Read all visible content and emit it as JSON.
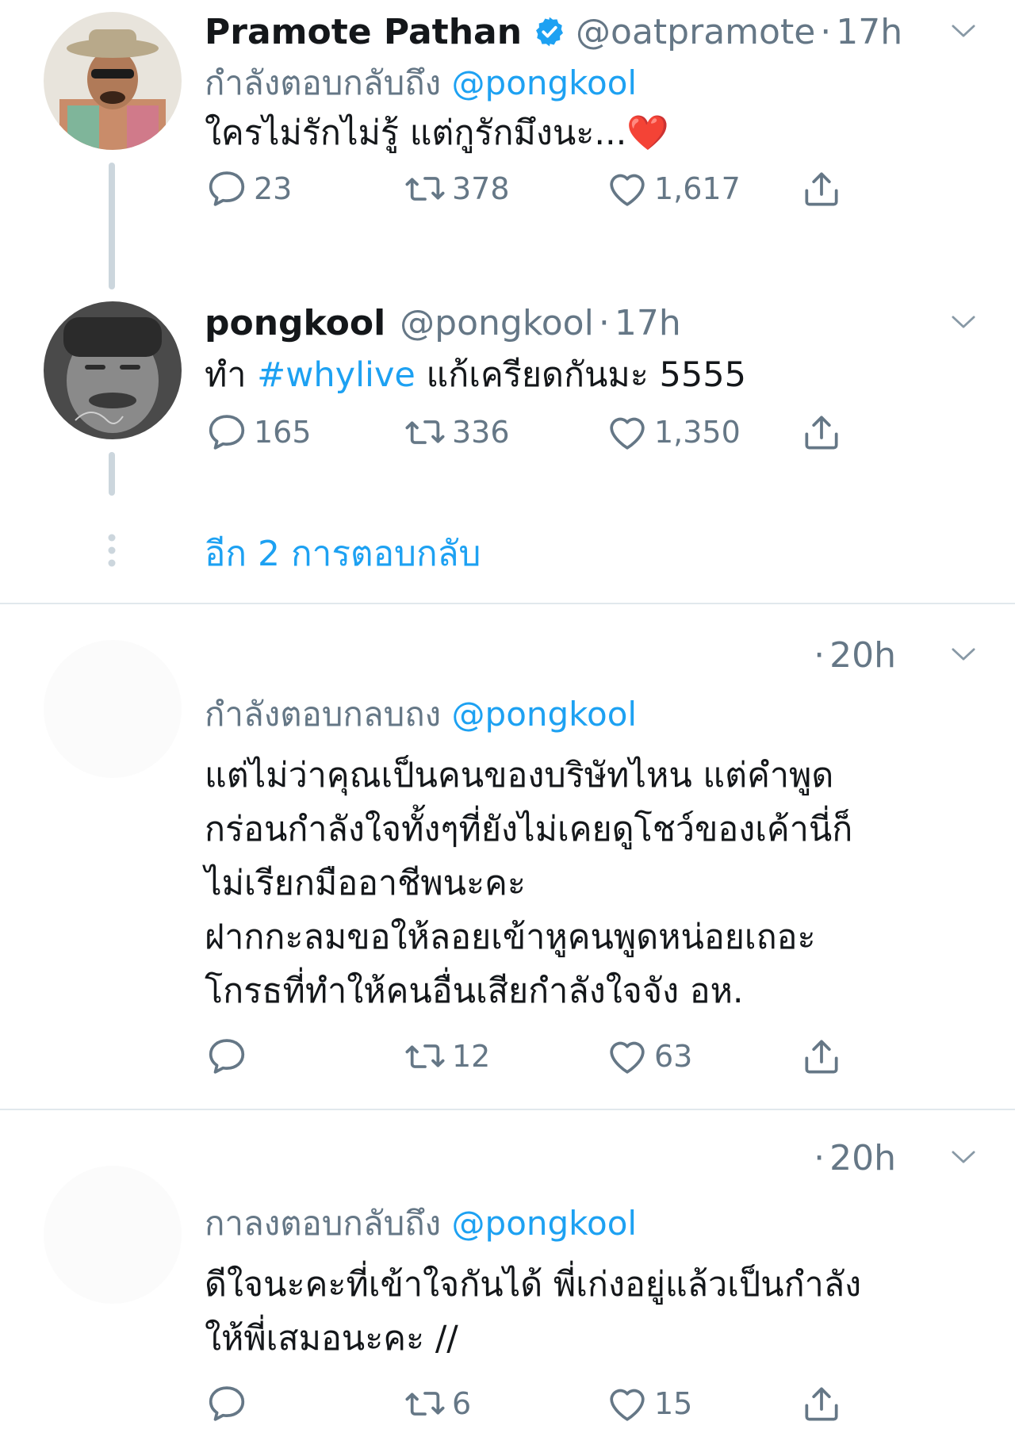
{
  "tweets": [
    {
      "name": "Pramote Pathan",
      "handle": "@oatpramote",
      "time": "17h",
      "replying_label": "กำลังตอบกลับถึง",
      "replying_to": "@pongkool",
      "text": "ใครไม่รักไม่รู้ แต่กูรักมึงนะ...",
      "emoji": "❤️",
      "replies": "23",
      "retweets": "378",
      "likes": "1,617"
    },
    {
      "name": "pongkool",
      "handle": "@pongkool",
      "time": "17h",
      "text_prefix": "ทำ",
      "hashtag": "#whylive",
      "text_suffix": "แก้เครียดกันมะ 5555",
      "replies": "165",
      "retweets": "336",
      "likes": "1,350"
    },
    {
      "time": "20h",
      "replying_label": "กำลังตอบกลบถง",
      "replying_to": "@pongkool",
      "lines": [
        "แต่ไม่ว่าคุณเป็นคนของบริษัทไหน แต่คำพูด",
        "กร่อนกำลังใจทั้งๆที่ยังไม่เคยดูโชว์ของเค้านี่ก็",
        "ไม่เรียกมืออาชีพนะคะ",
        "ฝากกะลมขอให้ลอยเข้าหูคนพูดหน่อยเถอะ",
        "โกรธที่ทำให้คนอื่นเสียกำลังใจจัง อห."
      ],
      "replies": "",
      "retweets": "12",
      "likes": "63"
    },
    {
      "time": "20h",
      "replying_label": "กาลงตอบกลับถึง",
      "replying_to": "@pongkool",
      "lines": [
        "ดีใจนะคะที่เข้าใจกันได้ พี่เก่งอยู่แล้วเป็นกำลัง",
        "ให้พี่เสมอนะคะ //"
      ],
      "replies": "",
      "retweets": "6",
      "likes": "15"
    }
  ],
  "more_replies_label": "อีก 2 การตอบกลับ",
  "colors": {
    "accent": "#1da1f2",
    "secondary_text": "#657786",
    "thread_line": "#ccd6dd",
    "separator": "#e1e8ed"
  },
  "icons": [
    "verified-badge-icon",
    "chevron-down-icon",
    "reply-icon",
    "retweet-icon",
    "like-icon",
    "share-icon",
    "more-dots-icon"
  ]
}
